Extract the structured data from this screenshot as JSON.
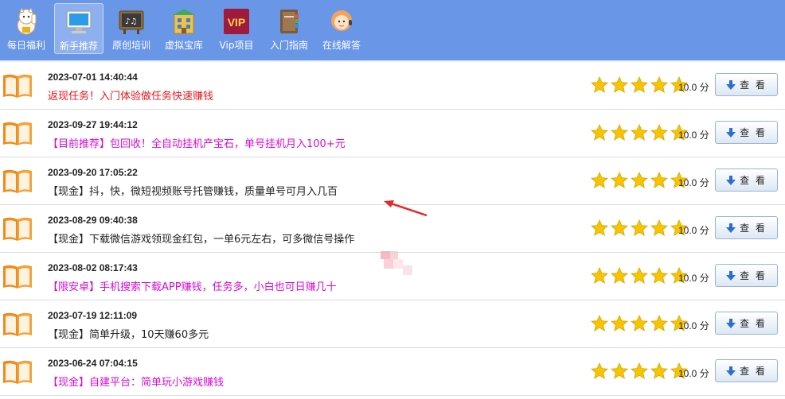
{
  "nav": {
    "items": [
      {
        "label": "每日福利",
        "icon": "lucky-cat-icon",
        "active": false
      },
      {
        "label": "新手推荐",
        "icon": "computer-icon",
        "active": true
      },
      {
        "label": "原创培训",
        "icon": "music-board-icon",
        "active": false
      },
      {
        "label": "虚拟宝库",
        "icon": "building-icon",
        "active": false
      },
      {
        "label": "Vip项目",
        "icon": "vip-icon",
        "active": false
      },
      {
        "label": "入门指南",
        "icon": "book-icon",
        "active": false
      },
      {
        "label": "在线解答",
        "icon": "support-girl-icon",
        "active": false
      }
    ],
    "vip_text": "VIP"
  },
  "rows": [
    {
      "date": "2023-07-01 14:40:44",
      "title": "返现任务！入门体验做任务快速赚钱",
      "color": "red",
      "score": "10.0 分",
      "button": "查 看",
      "rating": 5
    },
    {
      "date": "2023-09-27 19:44:12",
      "title": "【目前推荐】包回收！全自动挂机产宝石，单号挂机月入100+元",
      "color": "magenta",
      "score": "10.0 分",
      "button": "查 看",
      "rating": 5
    },
    {
      "date": "2023-09-20 17:05:22",
      "title": "【现金】抖，快，微短视频账号托管赚钱，质量单号可月入几百",
      "color": "black",
      "score": "10.0 分",
      "button": "查 看",
      "rating": 5
    },
    {
      "date": "2023-08-29 09:40:38",
      "title": "【现金】下载微信游戏领现金红包，一单6元左右，可多微信号操作",
      "color": "black",
      "score": "10.0 分",
      "button": "查 看",
      "rating": 5
    },
    {
      "date": "2023-08-02 08:17:43",
      "title": "【限安卓】手机搜索下载APP赚钱，任务多，小白也可日赚几十",
      "color": "magenta",
      "score": "10.0 分",
      "button": "查 看",
      "rating": 5
    },
    {
      "date": "2023-07-19 12:11:09",
      "title": "【现金】简单升级，10天赚60多元",
      "color": "black",
      "score": "10.0 分",
      "button": "查 看",
      "rating": 5
    },
    {
      "date": "2023-06-24 07:04:15",
      "title": "【现金】自建平台：简单玩小游戏赚钱",
      "color": "magenta",
      "score": "10.0 分",
      "button": "查 看",
      "rating": 5
    }
  ],
  "colors": {
    "nav_bg": "#6a96e8",
    "red": "#e8141c",
    "magenta": "#d70bd7",
    "star": "#f7c400",
    "book": "#f08a1c"
  }
}
